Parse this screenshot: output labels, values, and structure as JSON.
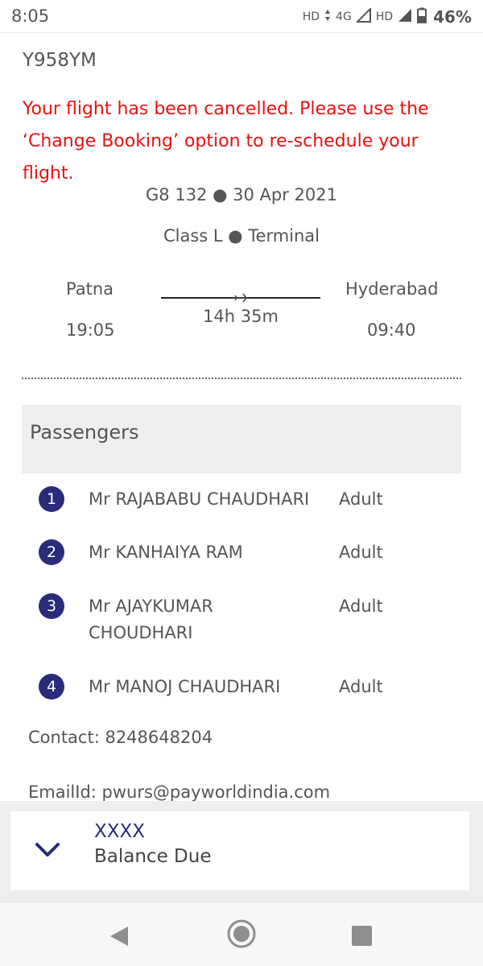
{
  "status": {
    "time": "8:05",
    "hd1": "HD",
    "network": "4G",
    "hd2": "HD",
    "battery": "46%"
  },
  "booking": {
    "pnr": "Y958YM",
    "cancel_message": "Your flight has been cancelled. Please use the ‘Change Booking’ option to re-schedule your flight.",
    "flight_line": "G8 132 ● 30 Apr 2021",
    "class_line": "Class L ● Terminal"
  },
  "route": {
    "origin": "Patna",
    "destination": "Hyderabad",
    "departure_time": "19:05",
    "arrival_time": "09:40",
    "duration": "14h 35m"
  },
  "passengers": {
    "title": "Passengers",
    "list": [
      {
        "num": "1",
        "name": "Mr RAJABABU CHAUDHARI",
        "type": "Adult"
      },
      {
        "num": "2",
        "name": "Mr KANHAIYA RAM",
        "type": "Adult"
      },
      {
        "num": "3",
        "name": "Mr AJAYKUMAR CHOUDHARI",
        "type": "Adult"
      },
      {
        "num": "4",
        "name": "Mr MANOJ CHAUDHARI",
        "type": "Adult"
      }
    ]
  },
  "contact": {
    "phone": "Contact: 8248648204",
    "email": "EmailId: pwurs@payworldindia.com"
  },
  "balance": {
    "amount": "XXXX",
    "label": "Balance Due"
  },
  "colors": {
    "accent": "#2a2c7a",
    "alert": "#e81010"
  },
  "icons": {
    "signal": "signal-icon",
    "battery": "battery-icon",
    "chevron": "chevron-down-icon",
    "back": "back-icon",
    "home": "home-icon",
    "recent": "recent-apps-icon"
  }
}
